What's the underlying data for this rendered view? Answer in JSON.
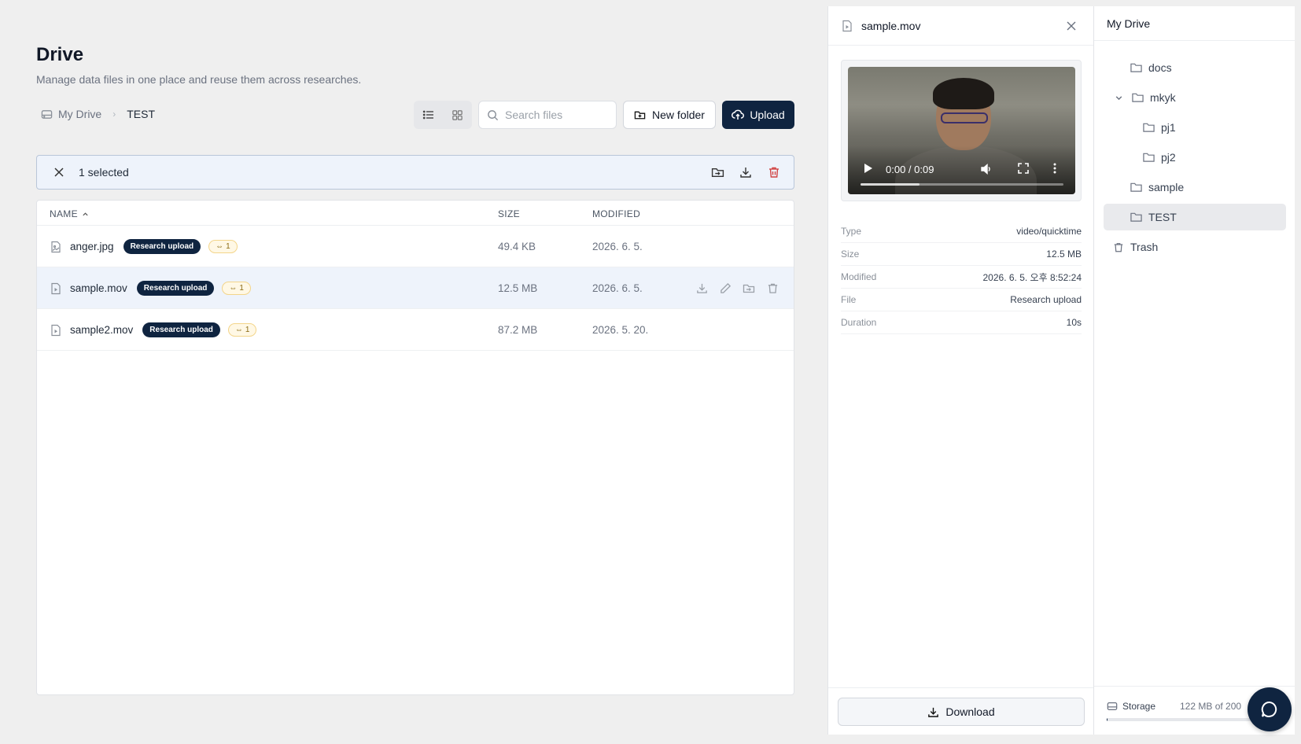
{
  "page": {
    "title": "Drive",
    "subtitle": "Manage data files in one place and reuse them across researches."
  },
  "breadcrumb": {
    "root": "My Drive",
    "current": "TEST"
  },
  "search": {
    "placeholder": "Search files"
  },
  "toolbar": {
    "new_folder_label": "New folder",
    "upload_label": "Upload"
  },
  "selection": {
    "text": "1 selected"
  },
  "table": {
    "headers": {
      "name": "NAME",
      "size": "SIZE",
      "modified": "MODIFIED"
    },
    "rows": [
      {
        "name": "anger.jpg",
        "tag": "Research upload",
        "links": "1",
        "size": "49.4 KB",
        "modified": "2026. 6. 5."
      },
      {
        "name": "sample.mov",
        "tag": "Research upload",
        "links": "1",
        "size": "12.5 MB",
        "modified": "2026. 6. 5."
      },
      {
        "name": "sample2.mov",
        "tag": "Research upload",
        "links": "1",
        "size": "87.2 MB",
        "modified": "2026. 5. 20."
      }
    ]
  },
  "detail": {
    "file_name": "sample.mov",
    "video": {
      "time": "0:00 / 0:09",
      "buffered": 0.29
    },
    "properties": [
      {
        "label": "Type",
        "value": "video/quicktime"
      },
      {
        "label": "Size",
        "value": "12.5 MB"
      },
      {
        "label": "Modified",
        "value": "2026. 6. 5. 오후 8:52:24"
      },
      {
        "label": "File",
        "value": "Research upload"
      },
      {
        "label": "Duration",
        "value": "10s"
      }
    ],
    "download_label": "Download"
  },
  "tree": {
    "title": "My Drive",
    "items": [
      {
        "label": "docs"
      },
      {
        "label": "mkyk"
      },
      {
        "label": "pj1"
      },
      {
        "label": "pj2"
      },
      {
        "label": "sample"
      },
      {
        "label": "TEST"
      },
      {
        "label": "Trash"
      }
    ],
    "storage_label": "Storage",
    "storage_value": "122 MB of 200",
    "storage_used": 0.005
  },
  "colors": {
    "accent": "#0f2440",
    "selection_bg": "#eef3fb",
    "badge_bg": "#fff8e5",
    "danger": "#d14343"
  }
}
